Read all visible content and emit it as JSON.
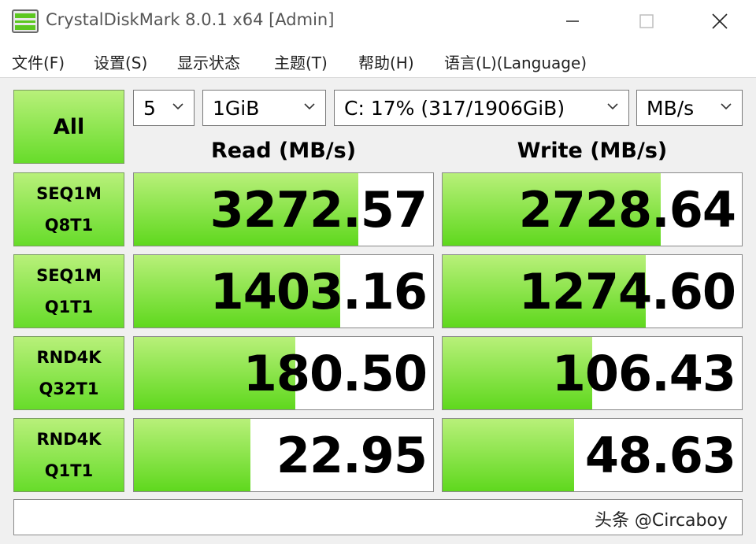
{
  "window": {
    "title": "CrystalDiskMark 8.0.1 x64 [Admin]",
    "icon": "disk-icon",
    "controls": [
      "minimize-icon",
      "maximize-icon",
      "close-icon"
    ]
  },
  "menu": [
    {
      "label": "文件(F)"
    },
    {
      "label": "设置(S)"
    },
    {
      "label": "显示状态"
    },
    {
      "label": "主题(T)"
    },
    {
      "label": "帮助(H)"
    },
    {
      "label": "语言(L)(Language)"
    }
  ],
  "toolbar": {
    "all_label": "All",
    "count": "5",
    "size": "1GiB",
    "drive": "C: 17% (317/1906GiB)",
    "unit": "MB/s"
  },
  "headers": {
    "read": "Read (MB/s)",
    "write": "Write (MB/s)"
  },
  "tests": [
    {
      "line1": "SEQ1M",
      "line2": "Q8T1",
      "read": "3272.57",
      "write": "2728.64",
      "read_fill": 0.75,
      "write_fill": 0.73
    },
    {
      "line1": "SEQ1M",
      "line2": "Q1T1",
      "read": "1403.16",
      "write": "1274.60",
      "read_fill": 0.69,
      "write_fill": 0.68
    },
    {
      "line1": "RND4K",
      "line2": "Q32T1",
      "read": "180.50",
      "write": "106.43",
      "read_fill": 0.54,
      "write_fill": 0.5
    },
    {
      "line1": "RND4K",
      "line2": "Q1T1",
      "read": "22.95",
      "write": "48.63",
      "read_fill": 0.39,
      "write_fill": 0.44
    }
  ],
  "comment": {
    "watermark": "头条 @Circaboy"
  },
  "colors": {
    "bar_green": "#6ee02c",
    "label_green": "#8ee64a",
    "background": "#f0f0f0"
  }
}
